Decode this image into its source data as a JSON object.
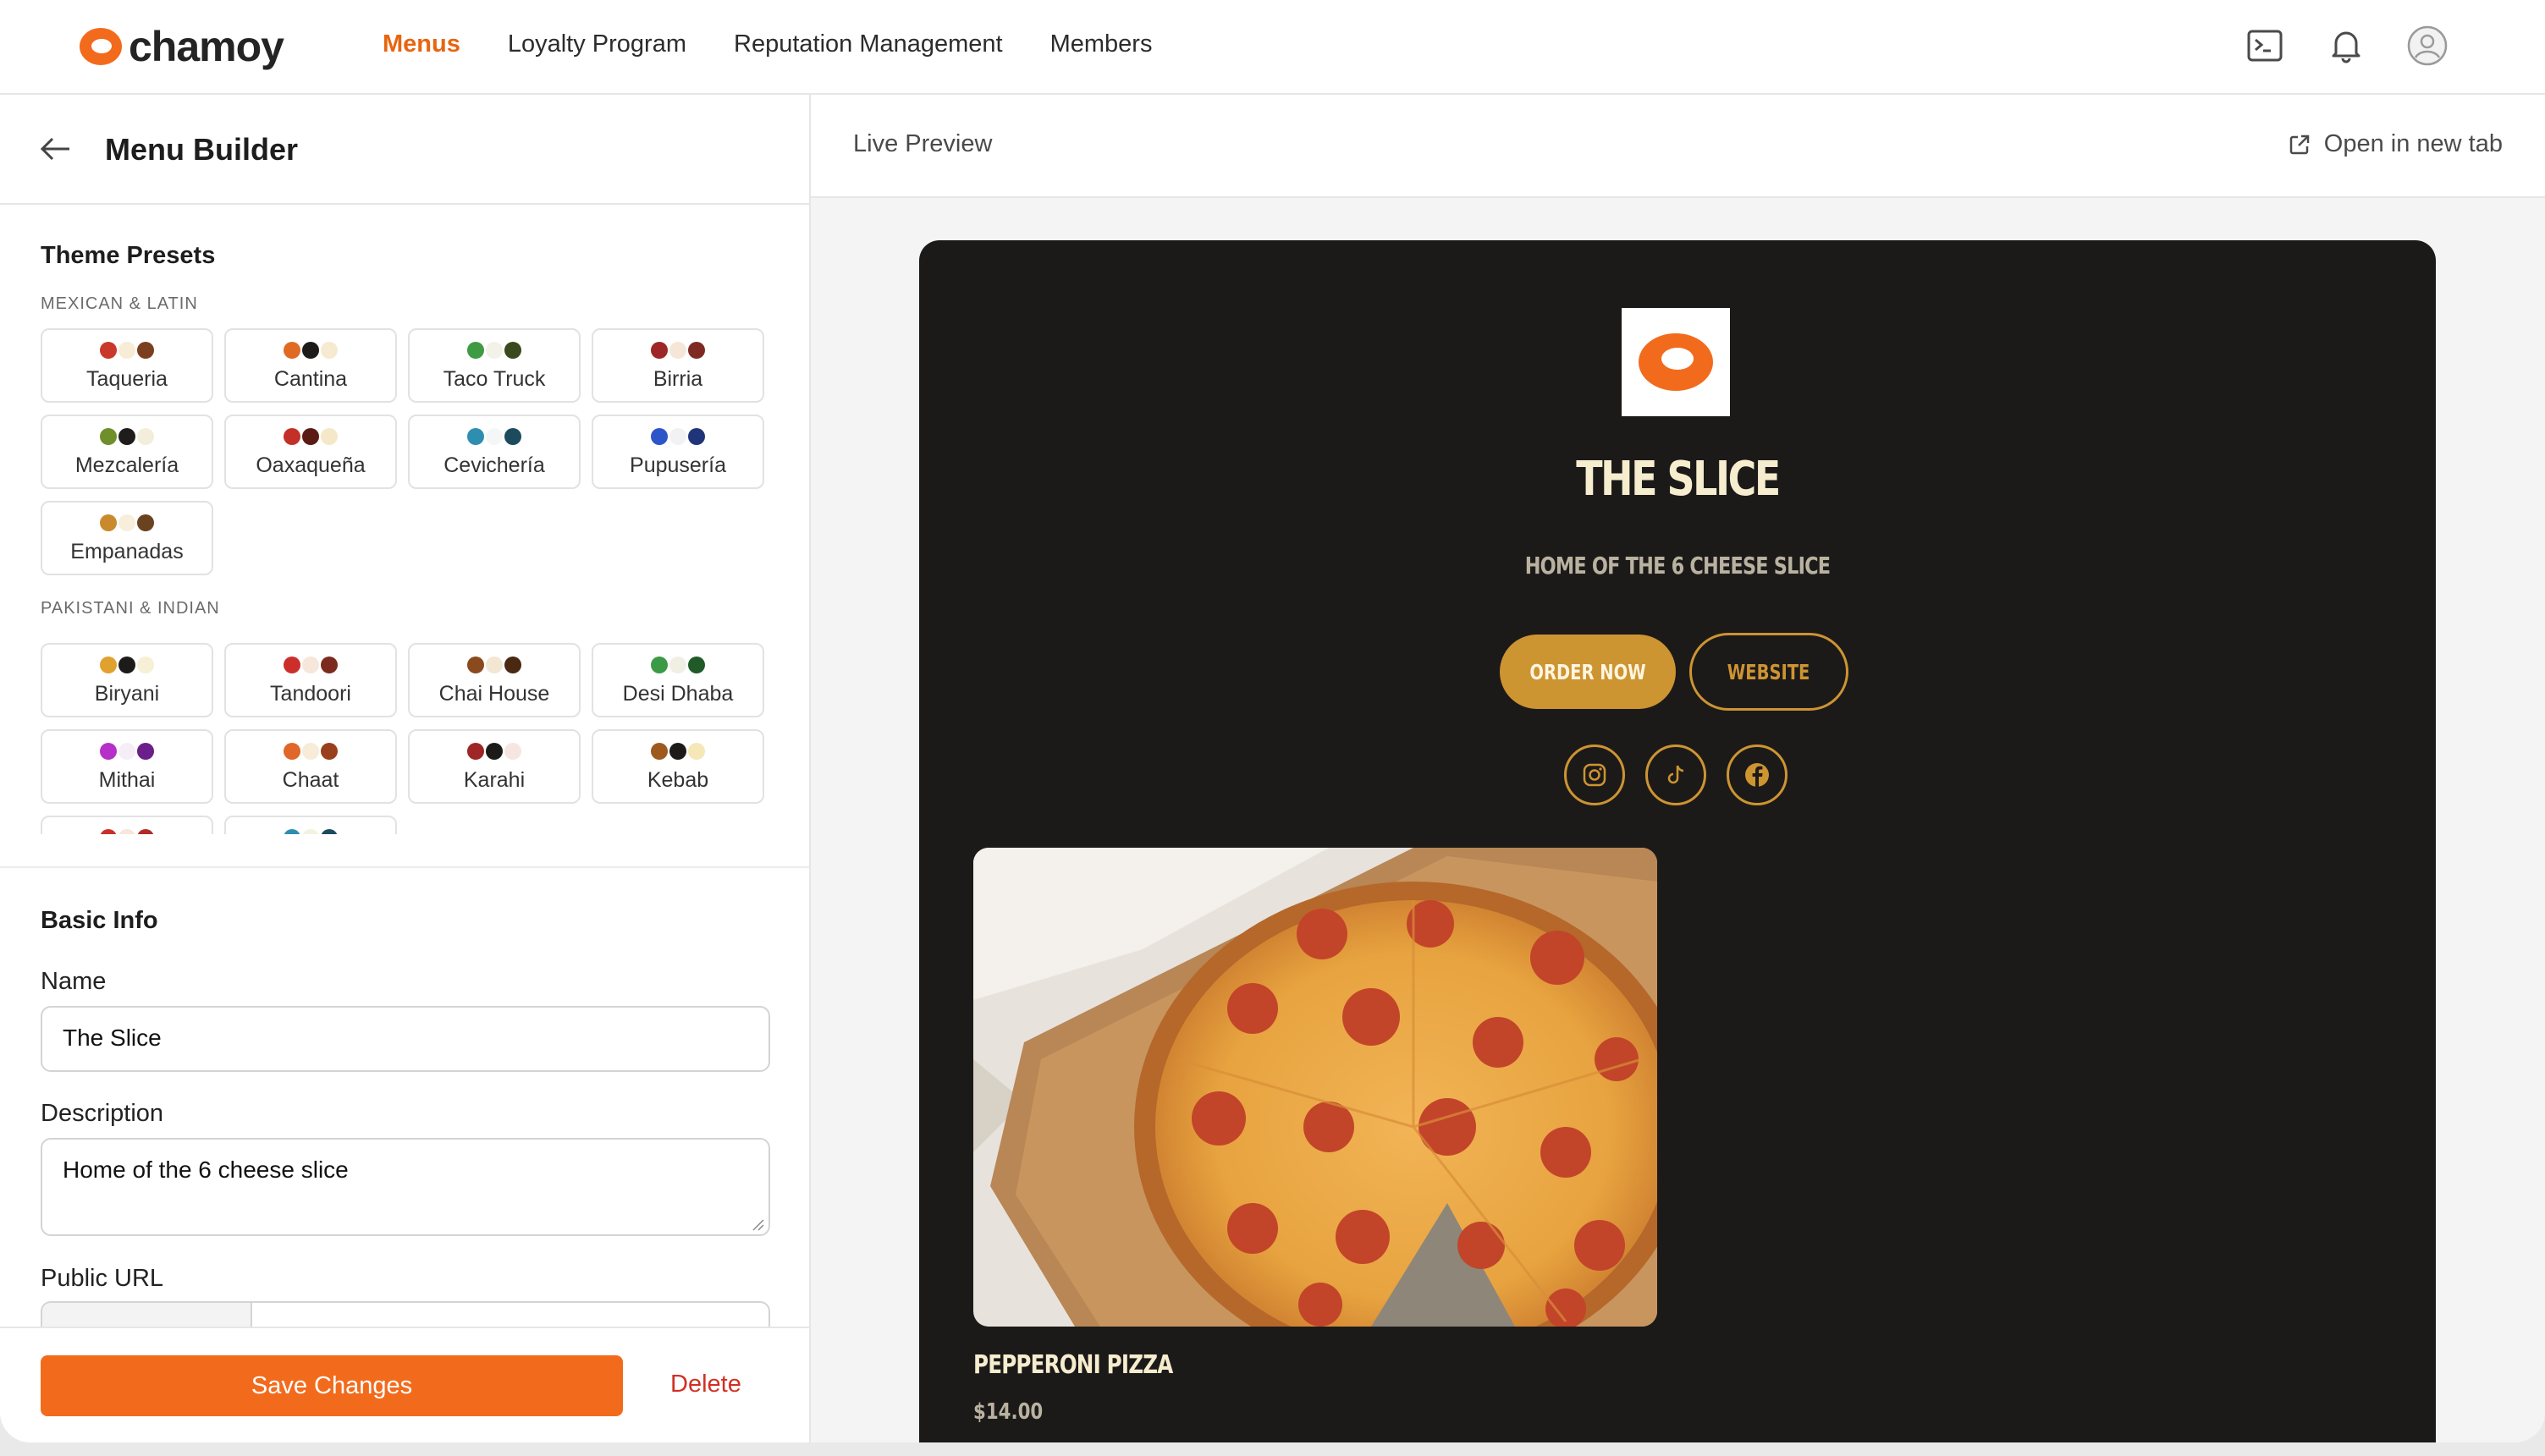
{
  "app": {
    "logo_text": "chamoy"
  },
  "nav": {
    "items": [
      {
        "label": "Menus",
        "active": true
      },
      {
        "label": "Loyalty Program"
      },
      {
        "label": "Reputation Management"
      },
      {
        "label": "Members"
      }
    ],
    "icons": [
      "terminal-icon",
      "bell-icon",
      "avatar-icon"
    ]
  },
  "left": {
    "title": "Menu Builder",
    "theme_presets": {
      "title": "Theme Presets",
      "groups": [
        {
          "label": "MEXICAN & LATIN",
          "items": [
            {
              "label": "Taqueria",
              "colors": [
                "#c9382b",
                "#f7ecd6",
                "#7a3f1e"
              ]
            },
            {
              "label": "Cantina",
              "colors": [
                "#e06a24",
                "#1d1b1a",
                "#f6ead0"
              ]
            },
            {
              "label": "Taco Truck",
              "colors": [
                "#3e9a43",
                "#f4f2e8",
                "#3a4a1e"
              ]
            },
            {
              "label": "Birria",
              "colors": [
                "#9e2626",
                "#f5e6d8",
                "#7e2a22"
              ]
            },
            {
              "label": "Mezcalería",
              "colors": [
                "#6e8f2a",
                "#1e1d1b",
                "#f3eedb"
              ]
            },
            {
              "label": "Oaxaqueña",
              "colors": [
                "#c33027",
                "#5b1b15",
                "#f5e8c9"
              ]
            },
            {
              "label": "Cevichería",
              "colors": [
                "#2e8eb0",
                "#f4f7f5",
                "#1c4b5e"
              ]
            },
            {
              "label": "Pupusería",
              "colors": [
                "#2e54c9",
                "#f2f2f4",
                "#20347a"
              ]
            },
            {
              "label": "Empanadas",
              "colors": [
                "#c98a2e",
                "#f7efdc",
                "#6b4220"
              ]
            }
          ]
        },
        {
          "label": "PAKISTANI & INDIAN",
          "items": [
            {
              "label": "Biryani",
              "colors": [
                "#e0a12e",
                "#1d1b1a",
                "#f7efd6"
              ]
            },
            {
              "label": "Tandoori",
              "colors": [
                "#cc2f2a",
                "#f6e7da",
                "#7c2a1e"
              ]
            },
            {
              "label": "Chai House",
              "colors": [
                "#8a4a1e",
                "#f3e7d3",
                "#4a2812"
              ]
            },
            {
              "label": "Desi Dhaba",
              "colors": [
                "#3b9a46",
                "#f1efe4",
                "#1f5a28"
              ]
            },
            {
              "label": "Mithai",
              "colors": [
                "#b62fc9",
                "#f6eef6",
                "#6a1f8a"
              ]
            },
            {
              "label": "Chaat",
              "colors": [
                "#e0662a",
                "#f6ecd8",
                "#9a3f1c"
              ]
            },
            {
              "label": "Karahi",
              "colors": [
                "#9e2626",
                "#1d1b1a",
                "#f6e6e2"
              ]
            },
            {
              "label": "Kebab",
              "colors": [
                "#9e5a1e",
                "#1d1b1a",
                "#f6e7b8"
              ]
            },
            {
              "label": "",
              "colors": [
                "#cc2f2a",
                "#f6e7da",
                "#b32a2a"
              ]
            },
            {
              "label": "",
              "colors": [
                "#2e8eb0",
                "#f4f2e0",
                "#1c4b5e"
              ]
            }
          ]
        }
      ]
    },
    "basic_info": {
      "title": "Basic Info",
      "name_label": "Name",
      "name_value": "The Slice",
      "description_label": "Description",
      "description_value": "Home of the 6 cheese slice",
      "public_url_label": "Public URL"
    },
    "footer": {
      "save_label": "Save Changes",
      "delete_label": "Delete"
    }
  },
  "preview": {
    "title": "Live Preview",
    "open_tab_label": "Open in new tab",
    "restaurant_name": "THE SLICE",
    "tagline": "HOME OF THE 6 CHEESE SLICE",
    "order_label": "ORDER NOW",
    "website_label": "WEBSITE",
    "socials": [
      "instagram-icon",
      "tiktok-icon",
      "facebook-icon"
    ],
    "item": {
      "name": "PEPPERONI PIZZA",
      "price": "$14.00"
    },
    "accent": "#cd9432",
    "background": "#1c1a19"
  }
}
